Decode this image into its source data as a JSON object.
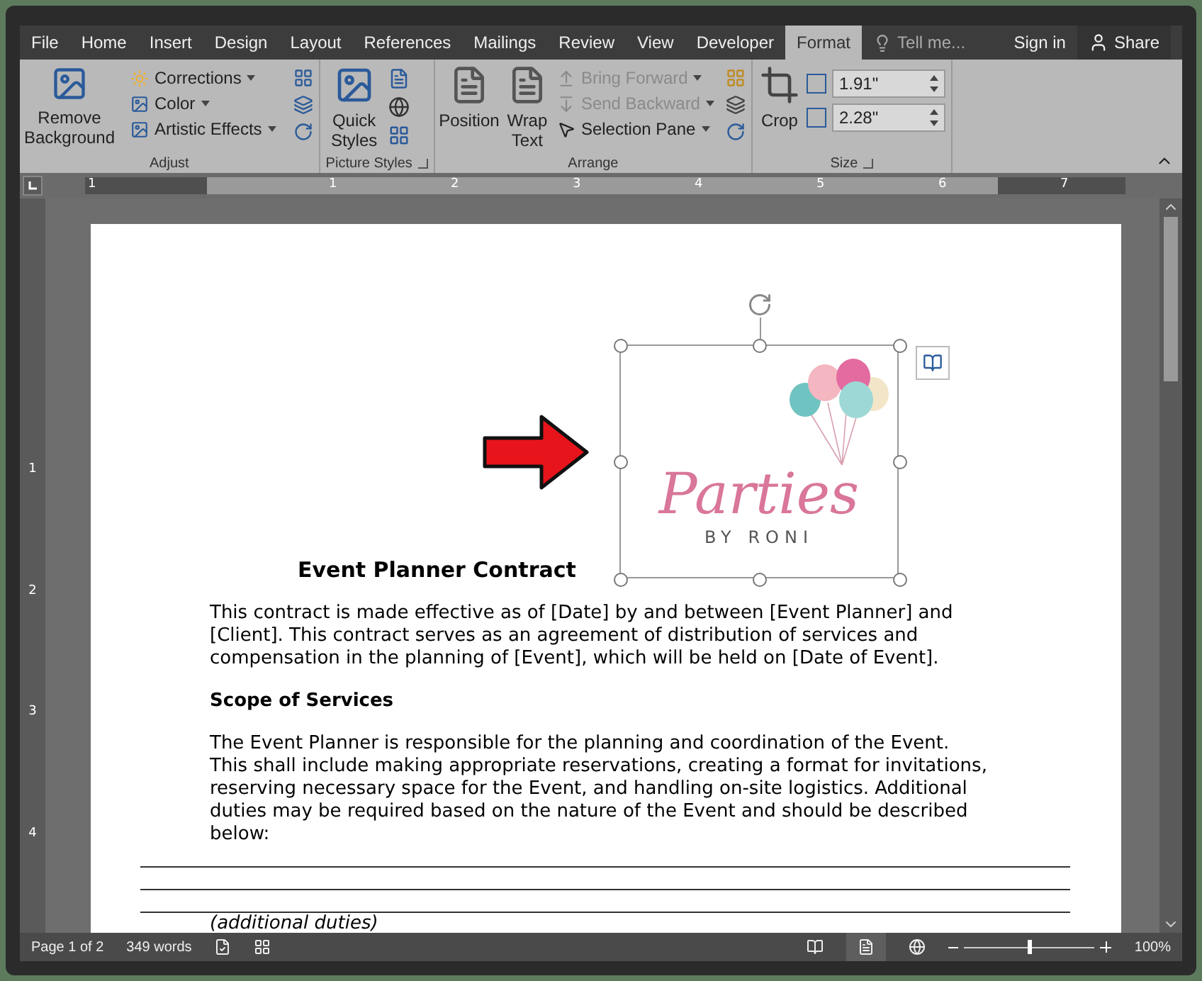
{
  "tabs": [
    {
      "label": "File",
      "selected": false
    },
    {
      "label": "Home",
      "selected": false
    },
    {
      "label": "Insert",
      "selected": false
    },
    {
      "label": "Design",
      "selected": false
    },
    {
      "label": "Layout",
      "selected": false
    },
    {
      "label": "References",
      "selected": false
    },
    {
      "label": "Mailings",
      "selected": false
    },
    {
      "label": "Review",
      "selected": false
    },
    {
      "label": "View",
      "selected": false
    },
    {
      "label": "Developer",
      "selected": false
    },
    {
      "label": "Format",
      "selected": true
    }
  ],
  "tell_me": {
    "placeholder": "Tell me..."
  },
  "account": {
    "sign_in": "Sign in",
    "share": "Share"
  },
  "ribbon": {
    "adjust": {
      "label": "Adjust",
      "remove_background": "Remove Background",
      "items": [
        {
          "label": "Corrections",
          "disabled": false
        },
        {
          "label": "Color",
          "disabled": false
        },
        {
          "label": "Artistic Effects",
          "disabled": false
        }
      ]
    },
    "picture_styles": {
      "label": "Picture Styles",
      "quick_styles": [
        "Quick",
        "Styles"
      ]
    },
    "arrange": {
      "label": "Arrange",
      "position": "Position",
      "wrap_text": [
        "Wrap",
        "Text"
      ],
      "items": [
        {
          "label": "Bring Forward",
          "disabled": true
        },
        {
          "label": "Send Backward",
          "disabled": true
        },
        {
          "label": "Selection Pane",
          "disabled": false
        }
      ]
    },
    "size": {
      "label": "Size",
      "crop": "Crop",
      "height": "1.91\"",
      "width": "2.28\""
    }
  },
  "ruler": {
    "numbers": [
      "1",
      "1",
      "2",
      "3",
      "4",
      "5",
      "6",
      "7"
    ],
    "vertical_numbers": [
      "1",
      "2",
      "3",
      "4"
    ]
  },
  "document": {
    "title": "Event Planner Contract",
    "image": {
      "script_text": "Parties",
      "tagline": "BY RONI"
    },
    "paragraphs": [
      {
        "kind": "text",
        "lines": [
          "This contract is made effective as of [Date] by and between [Event Planner] and",
          "[Client]. This contract serves as an agreement of distribution of services and",
          "compensation in the planning of [Event], which will be held on [Date of Event]."
        ]
      },
      {
        "kind": "heading",
        "lines": [
          "Scope of Services"
        ]
      },
      {
        "kind": "text",
        "lines": [
          "The Event Planner is responsible for the planning and coordination of the Event.",
          "This shall include making appropriate reservations, creating a format for invitations,",
          "reserving necessary space for the Event, and handling on-site logistics. Additional",
          "duties may be required based on the nature of the Event and should be described",
          "below:"
        ]
      }
    ],
    "note": "(additional duties)"
  },
  "status_bar": {
    "page": "Page 1 of 2",
    "words": "349 words",
    "zoom": {
      "level": 0.48
    },
    "zoom_text": "100%"
  }
}
